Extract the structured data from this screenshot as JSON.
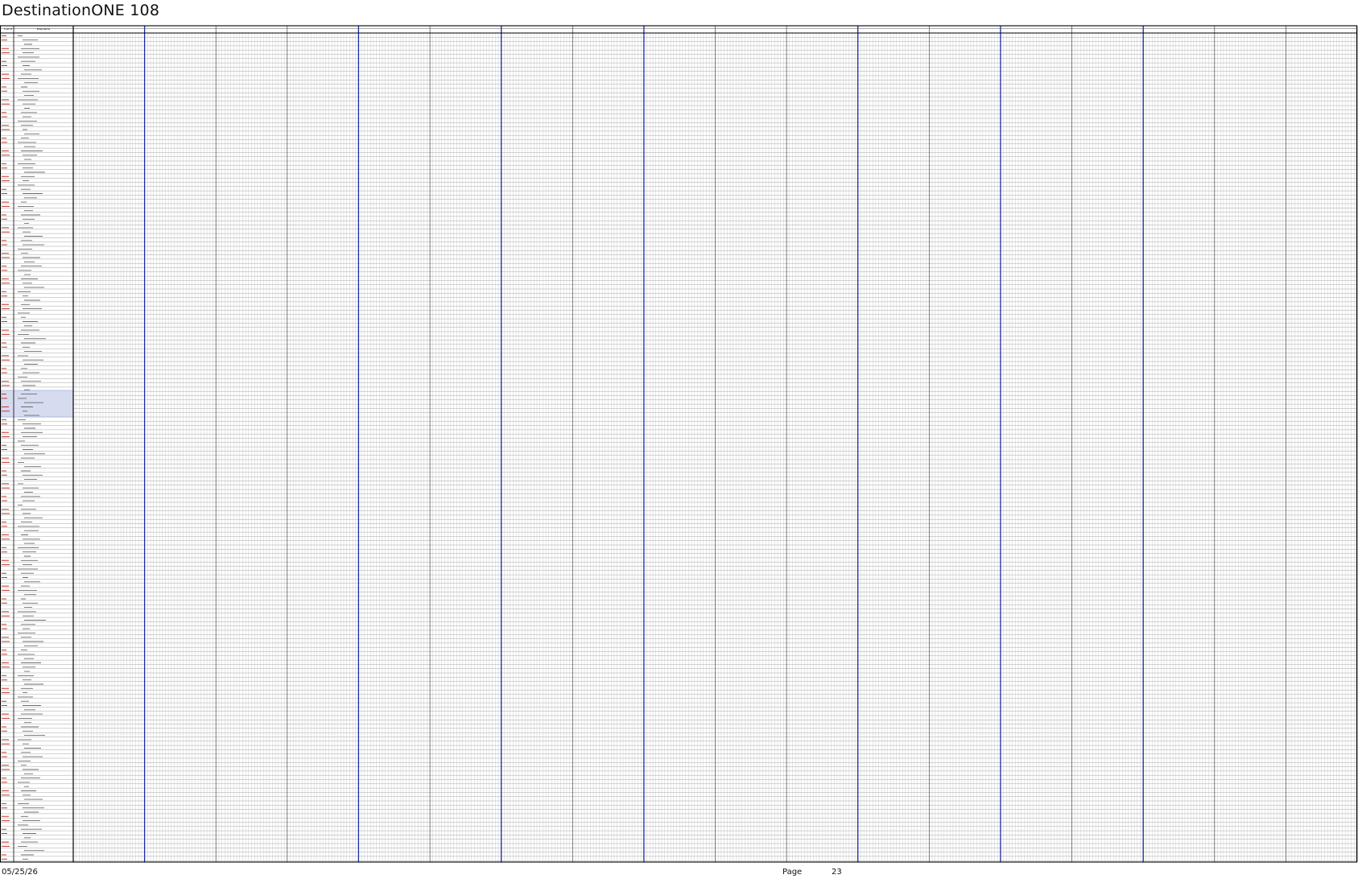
{
  "document": {
    "title": "DestinationONE 108"
  },
  "table": {
    "headers": [
      "Cust #",
      "Bldg Name"
    ],
    "month_groups": 18,
    "cells_per_group": 24,
    "section_dividers_after_group": [
      1,
      4,
      6,
      8,
      11,
      13,
      15
    ],
    "colors": {
      "grid": "#9a9a9a",
      "frame": "#000000",
      "divider": "#1a2aa8",
      "red_text": "#c0392b",
      "selection_fill": "#d6dbf0"
    }
  },
  "footer": {
    "date": "05/25/26",
    "page_label": "Page",
    "page_number": "23"
  }
}
